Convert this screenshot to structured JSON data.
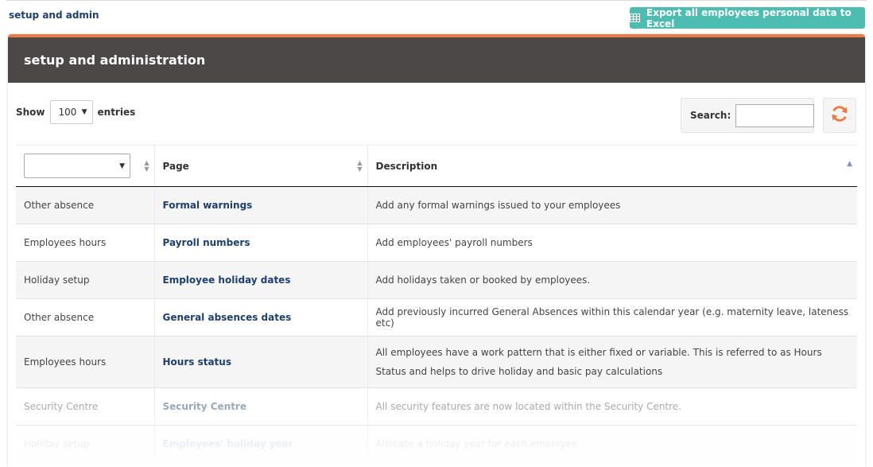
{
  "breadcrumb": "setup and admin",
  "export_button": {
    "label": "Export all employees personal data to Excel",
    "icon": "table-icon"
  },
  "panel": {
    "title": "setup and administration",
    "accent": "#ee7a43",
    "header_bg": "#4b4847"
  },
  "length_control": {
    "show_label": "Show",
    "value": "100",
    "entries_label": "entries"
  },
  "search": {
    "label": "Search:",
    "value": ""
  },
  "refresh_icon": "refresh-icon",
  "table": {
    "columns": {
      "filter_value": "",
      "page": "Page",
      "description": "Description"
    },
    "rows": [
      {
        "category": "Other absence",
        "page": "Formal warnings",
        "description": "Add any formal warnings issued to your employees"
      },
      {
        "category": "Employees hours",
        "page": "Payroll numbers",
        "description": "Add employees' payroll numbers"
      },
      {
        "category": "Holiday setup",
        "page": "Employee holiday dates",
        "description": "Add holidays taken or booked by employees."
      },
      {
        "category": "Other absence",
        "page": "General absences dates",
        "description": "Add previously incurred General Absences within this calendar year (e.g. maternity leave, lateness etc)"
      },
      {
        "category": "Employees hours",
        "page": "Hours status",
        "description": "All employees have a work pattern that is either fixed or variable. This is referred to as Hours Status and helps to drive holiday and basic pay calculations"
      },
      {
        "category": "Security Centre",
        "page": "Security Centre",
        "description": "All security features are now located within the Security Centre."
      },
      {
        "category": "Holiday setup",
        "page": "Employees' holiday year",
        "description": "Allocate a holiday year for each employee"
      }
    ]
  }
}
